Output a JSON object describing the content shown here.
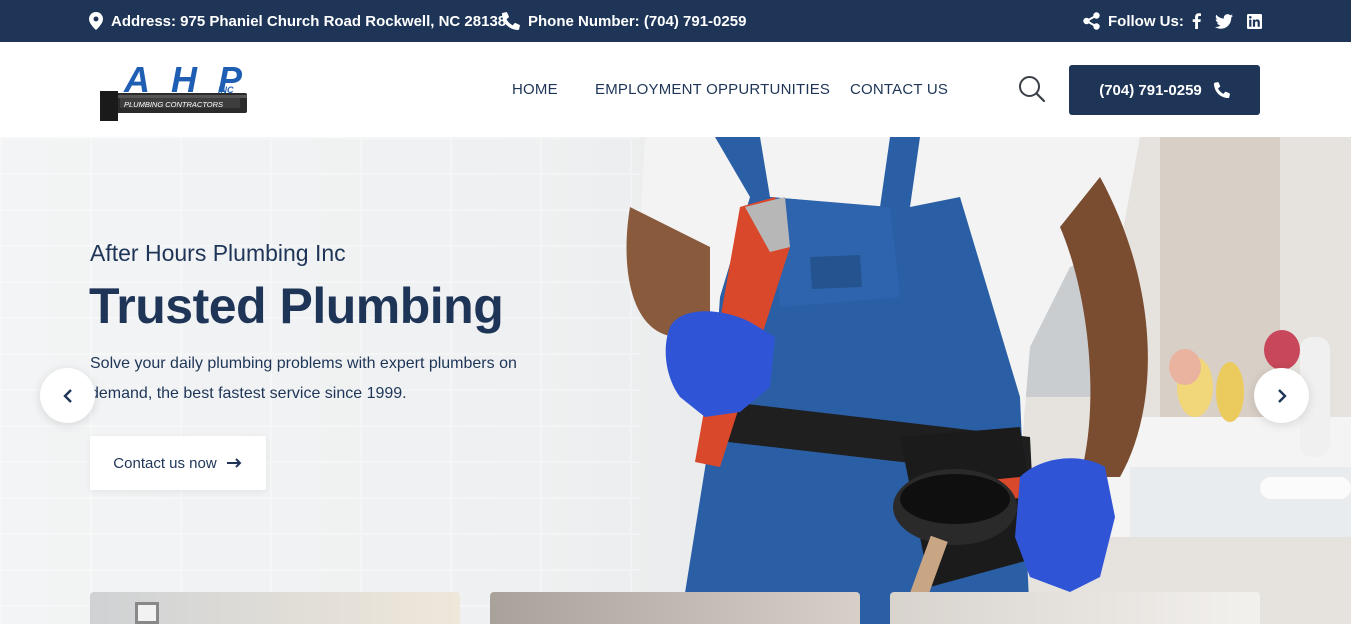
{
  "topbar": {
    "address": "Address: 975 Phaniel Church Road Rockwell, NC 28138",
    "phone": "Phone Number: (704) 791-0259",
    "follow": "Follow Us:",
    "icons": [
      "map-pin-icon",
      "phone-icon",
      "share-icon",
      "facebook-icon",
      "twitter-icon",
      "linkedin-icon"
    ]
  },
  "header": {
    "logo_text": "AHP",
    "logo_sub": "INC",
    "logo_tagline": "PLUMBING CONTRACTORS",
    "nav": [
      "HOME",
      "EMPLOYMENT OPPURTUNITIES",
      "CONTACT US"
    ],
    "call_label": "(704) 791-0259"
  },
  "hero": {
    "subtitle": "After Hours Plumbing Inc",
    "title": "Trusted Plumbing",
    "description": "Solve your daily plumbing problems with expert plumbers on demand, the best fastest service since 1999.",
    "cta_label": "Contact us now"
  },
  "colors": {
    "navy": "#1e3557",
    "logo_blue": "#1f5fb3",
    "overall_blue": "#2a5fa6",
    "glove_blue": "#2f55d6",
    "wrench_orange": "#d9482b"
  }
}
